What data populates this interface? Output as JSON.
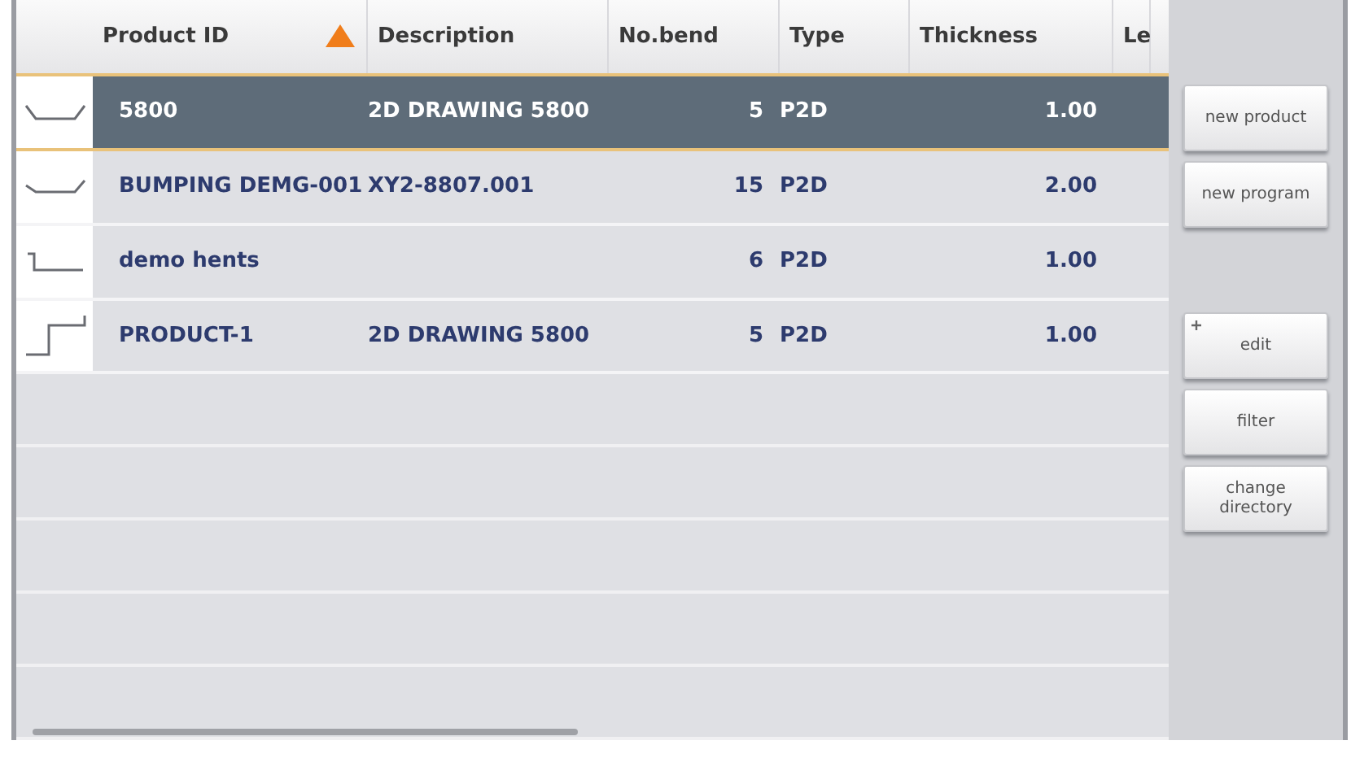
{
  "table": {
    "columns": [
      {
        "label": "Product ID",
        "sorted": true
      },
      {
        "label": "Description",
        "sorted": false
      },
      {
        "label": "No.bend",
        "sorted": false
      },
      {
        "label": "Type",
        "sorted": false
      },
      {
        "label": "Thickness",
        "sorted": false
      },
      {
        "label": "Le",
        "sorted": false
      }
    ],
    "rows": [
      {
        "kind": "channel",
        "product_id": "5800",
        "description": "2D DRAWING 5800",
        "bends": "5",
        "type": "P2D",
        "thickness": "1.00",
        "selected": true
      },
      {
        "kind": "shallow-channel",
        "product_id": "BUMPING DEMG-001",
        "description": "XY2-8807.001",
        "bends": "15",
        "type": "P2D",
        "thickness": "2.00",
        "selected": false
      },
      {
        "kind": "low-step",
        "product_id": "demo hents",
        "bends": "6",
        "type": "P2D",
        "thickness": "1.00",
        "selected": false
      },
      {
        "kind": "high-step",
        "product_id": "PRODUCT-1",
        "description": "2D DRAWING 5800",
        "bends": "5",
        "type": "P2D",
        "thickness": "1.00",
        "selected": false
      }
    ]
  },
  "buttons": [
    {
      "label": "new product",
      "marked": false
    },
    {
      "label": "new program",
      "marked": false
    },
    {
      "label": "edit",
      "marked": true
    },
    {
      "label": "filter",
      "marked": false
    },
    {
      "label": "change directory",
      "marked": false
    }
  ]
}
